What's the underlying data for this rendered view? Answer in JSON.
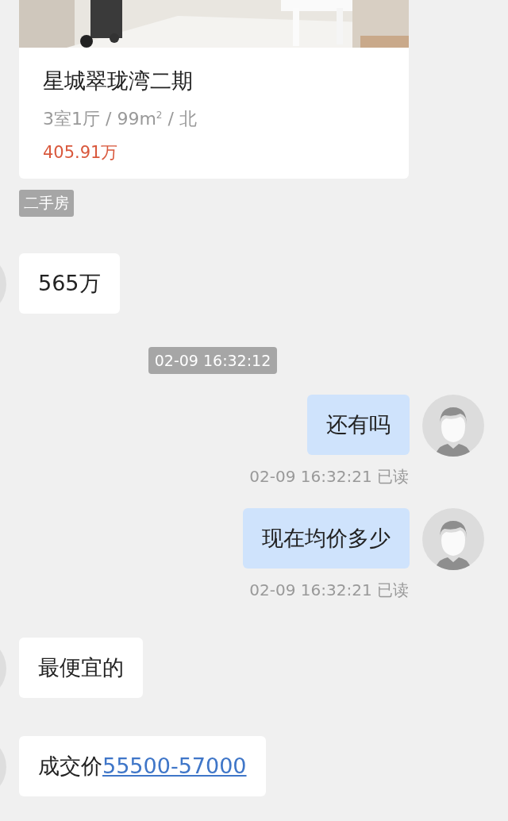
{
  "messages": [
    {
      "kind": "listing",
      "title": "星城翠珑湾二期",
      "specs": "3室1厅 / 99m$^{2}$ / 北",
      "price": "405.91万",
      "tag": "二手房"
    },
    {
      "kind": "in",
      "text": "565万"
    },
    {
      "kind": "time",
      "text": "02-09 16:32:12"
    },
    {
      "kind": "out",
      "text": "还有吗",
      "meta": "02-09 16:32:21 已读"
    },
    {
      "kind": "out",
      "text": "现在均价多少",
      "meta": "02-09 16:32:21 已读"
    },
    {
      "kind": "in",
      "text": "最便宜的"
    },
    {
      "kind": "in",
      "text": "成交价",
      "link": "55500-57000"
    }
  ]
}
